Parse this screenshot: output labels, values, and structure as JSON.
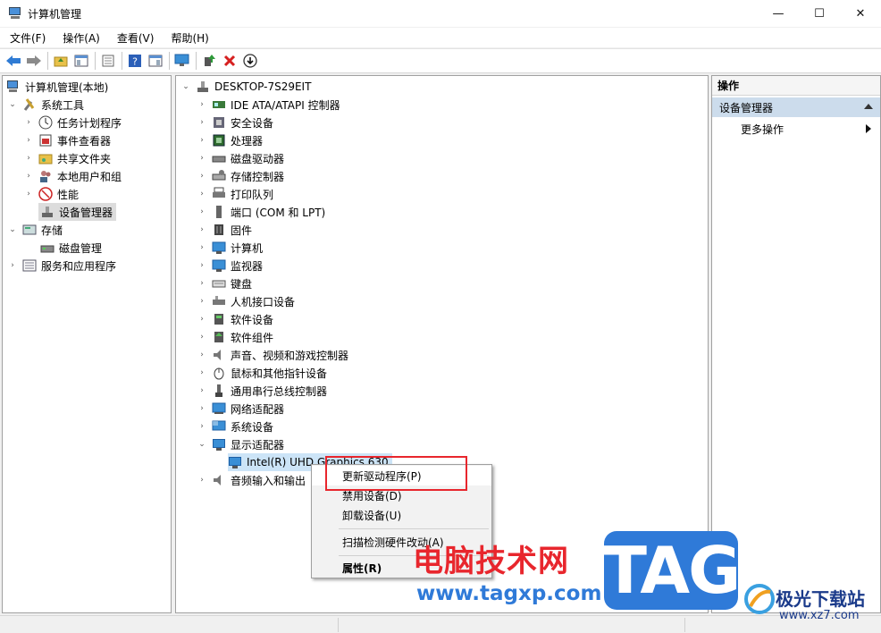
{
  "window": {
    "title": "计算机管理",
    "minimize": "—",
    "maximize": "☐",
    "close": "✕"
  },
  "menu": [
    "文件(F)",
    "操作(A)",
    "查看(V)",
    "帮助(H)"
  ],
  "left_tree": {
    "root": "计算机管理(本地)",
    "system_tools": "系统工具",
    "task_scheduler": "任务计划程序",
    "event_viewer": "事件查看器",
    "shared_folders": "共享文件夹",
    "local_users": "本地用户和组",
    "performance": "性能",
    "device_manager": "设备管理器",
    "storage": "存储",
    "disk_management": "磁盘管理",
    "services_apps": "服务和应用程序"
  },
  "device_tree": {
    "root": "DESKTOP-7S29EIT",
    "categories": [
      "IDE ATA/ATAPI 控制器",
      "安全设备",
      "处理器",
      "磁盘驱动器",
      "存储控制器",
      "打印队列",
      "端口 (COM 和 LPT)",
      "固件",
      "计算机",
      "监视器",
      "键盘",
      "人机接口设备",
      "软件设备",
      "软件组件",
      "声音、视频和游戏控制器",
      "鼠标和其他指针设备",
      "通用串行总线控制器",
      "网络适配器",
      "系统设备"
    ],
    "display_adapters": "显示适配器",
    "gpu": "Intel(R) UHD Graphics 630",
    "audio_io": "音频输入和输出"
  },
  "actions": {
    "header": "操作",
    "section": "设备管理器",
    "more": "更多操作"
  },
  "context_menu": {
    "update_driver": "更新驱动程序(P)",
    "disable_device": "禁用设备(D)",
    "uninstall_device": "卸载设备(U)",
    "scan_hardware": "扫描检测硬件改动(A)",
    "properties": "属性(R)"
  },
  "watermark": {
    "site_name": "电脑技术网",
    "site_url": "www.tagxp.com",
    "tag": "TAG",
    "brand": "极光下载站",
    "brand_url": "www.xz7.com"
  },
  "colors": {
    "accent": "#2f7ad8",
    "highlight_box": "#e8262d",
    "action_section": "#ccdcec",
    "watermark_red": "#e8262d"
  }
}
